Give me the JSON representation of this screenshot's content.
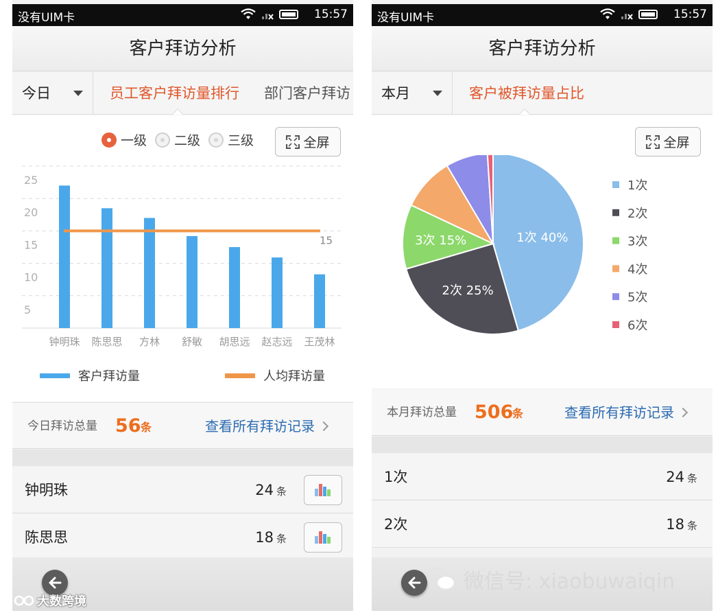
{
  "left": {
    "status": {
      "carrier": "没有UIM卡",
      "time": "15:57"
    },
    "title": "客户拜访分析",
    "period": "今日",
    "tabs": [
      "员工客户拜访量排行",
      "部门客户拜访"
    ],
    "levels": [
      "一级",
      "二级",
      "三级"
    ],
    "selected_level": "一级",
    "fullscreen_label": "全屏",
    "chart_legend": [
      "客户拜访量",
      "人均拜访量"
    ],
    "total_label": "今日拜访总量",
    "total_value": "56",
    "total_unit": "条",
    "view_all": "查看所有拜访记录",
    "rows": [
      {
        "name": "钟明珠",
        "count": "24",
        "unit": "条"
      },
      {
        "name": "陈思思",
        "count": "18",
        "unit": "条"
      }
    ]
  },
  "right": {
    "status": {
      "carrier": "没有UIM卡",
      "time": "15:57"
    },
    "title": "客户拜访分析",
    "period": "本月",
    "tab": "客户被拜访量占比",
    "fullscreen_label": "全屏",
    "total_label": "本月拜访总量",
    "total_value": "506",
    "total_unit": "条",
    "view_all": "查看所有拜访记录",
    "rows": [
      {
        "name": "1次",
        "count": "24",
        "unit": "条"
      },
      {
        "name": "2次",
        "count": "18",
        "unit": "条"
      }
    ]
  },
  "watermarks": {
    "left": "大数跨境",
    "right": "微信号: xiaobuwaiqin"
  },
  "colors": {
    "accent": "#e0572b",
    "total": "#ed6e1d",
    "link": "#2b6bb2",
    "bar": "#4aa8ea",
    "avg_line": "#f0964a"
  },
  "chart_data": [
    {
      "type": "bar",
      "categories": [
        "钟明珠",
        "陈思思",
        "方林",
        "舒敏",
        "胡思远",
        "赵志远",
        "王茂林"
      ],
      "series": [
        {
          "name": "客户拜访量",
          "values": [
            22,
            18.5,
            17,
            14.2,
            12.5,
            10.9,
            8.3
          ]
        },
        {
          "name": "人均拜访量",
          "values": [
            15,
            15,
            15,
            15,
            15,
            15,
            15
          ]
        }
      ],
      "avg_label": "15",
      "yticks": [
        "25",
        "20",
        "15",
        "10",
        "5"
      ],
      "ylim": [
        0,
        25
      ],
      "grid": true,
      "legend_position": "bottom"
    },
    {
      "type": "pie",
      "labels": [
        "1次",
        "2次",
        "3次",
        "4次",
        "5次",
        "6次"
      ],
      "values": [
        45.5,
        25,
        11.5,
        9.5,
        7.5,
        1
      ],
      "slice_labels": [
        "1次  40%",
        "2次  25%",
        "3次  15%",
        "",
        "",
        ""
      ],
      "colors": [
        "#8abde9",
        "#4f4e57",
        "#8cd86b",
        "#f4a86a",
        "#8d8ce8",
        "#e86077"
      ],
      "legend_position": "right"
    }
  ]
}
